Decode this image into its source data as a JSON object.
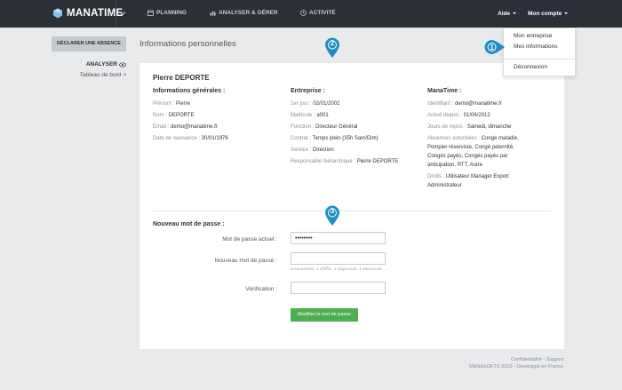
{
  "topbar": {
    "brand": "MANATIME",
    "nav": [
      "PLANNING",
      "ANALYSER & GÉRER",
      "ACTIVITÉ"
    ],
    "help": "Aide",
    "account": "Mon compte"
  },
  "dropdown": {
    "items": [
      "Mon entreprise",
      "Mes informations",
      "Déconnexion"
    ]
  },
  "sidebar": {
    "declare_button": "DÉCLARER UNE ABSENCE",
    "analyser": "ANALYSER",
    "dashboard_link": "Tableau de bord >"
  },
  "page": {
    "title": "Informations personnelles",
    "user_name": "Pierre DEPORTE"
  },
  "general": {
    "heading": "Informations générales :",
    "rows": [
      {
        "label": "Prénom : ",
        "value": "Pierre"
      },
      {
        "label": "Nom : ",
        "value": "DEPORTE"
      },
      {
        "label": "Email : ",
        "value": "demo@manatime.fr"
      },
      {
        "label": "Date de naissance : ",
        "value": "30/01/1976"
      }
    ]
  },
  "company": {
    "heading": "Entreprise :",
    "rows": [
      {
        "label": "1er jour : ",
        "value": "02/01/2002"
      },
      {
        "label": "Matricule : ",
        "value": "a001"
      },
      {
        "label": "Fonction : ",
        "value": "Directeur Général"
      },
      {
        "label": "Contrat : ",
        "value": "Temps plein (35h Sam/Dim)"
      },
      {
        "label": "Service : ",
        "value": "Direction"
      },
      {
        "label": "Responsable hiérarchique : ",
        "value": "Pierre DEPORTE"
      }
    ]
  },
  "manatime": {
    "heading": "ManaTime :",
    "identifiant_label": "Identifiant : ",
    "identifiant": "demo@manatime.fr",
    "active_label": "Activé depuis : ",
    "active": "01/06/2012",
    "repos_label": "Jours de repos : ",
    "repos": "Samedi, dimanche",
    "absences_label": "Absences autorisées : ",
    "absences_l1": "Congé maladie,",
    "absences_l2": "Pompier réserviste, Congé paternité,",
    "absences_l3": "Congés payés, Congés payés par",
    "absences_l4": "anticipation, RTT, Autre",
    "droits_label": "Droits : ",
    "droits_l1": "Utilisateur Manager Export",
    "droits_l2": "Administrateur"
  },
  "password": {
    "heading": "Nouveau mot de passe :",
    "current_label": "Mot de passe actuel :",
    "current_value": "••••••••",
    "new_label": "Nouveau mot de passe :",
    "hint": "8 caractères, 1 chiffre, 1 majuscule, 1 minuscule",
    "verify_label": "Vérification :",
    "submit": "Modifier le mot de passe"
  },
  "markers": [
    "1",
    "2",
    "3"
  ],
  "footer": {
    "links": "Confidentialité - Support",
    "copyright": "MANASOFT© 2019 - Développé en France"
  },
  "colors": {
    "topbar": "#2b3036",
    "marker": "#1b8ec5",
    "submit": "#4caf50"
  }
}
